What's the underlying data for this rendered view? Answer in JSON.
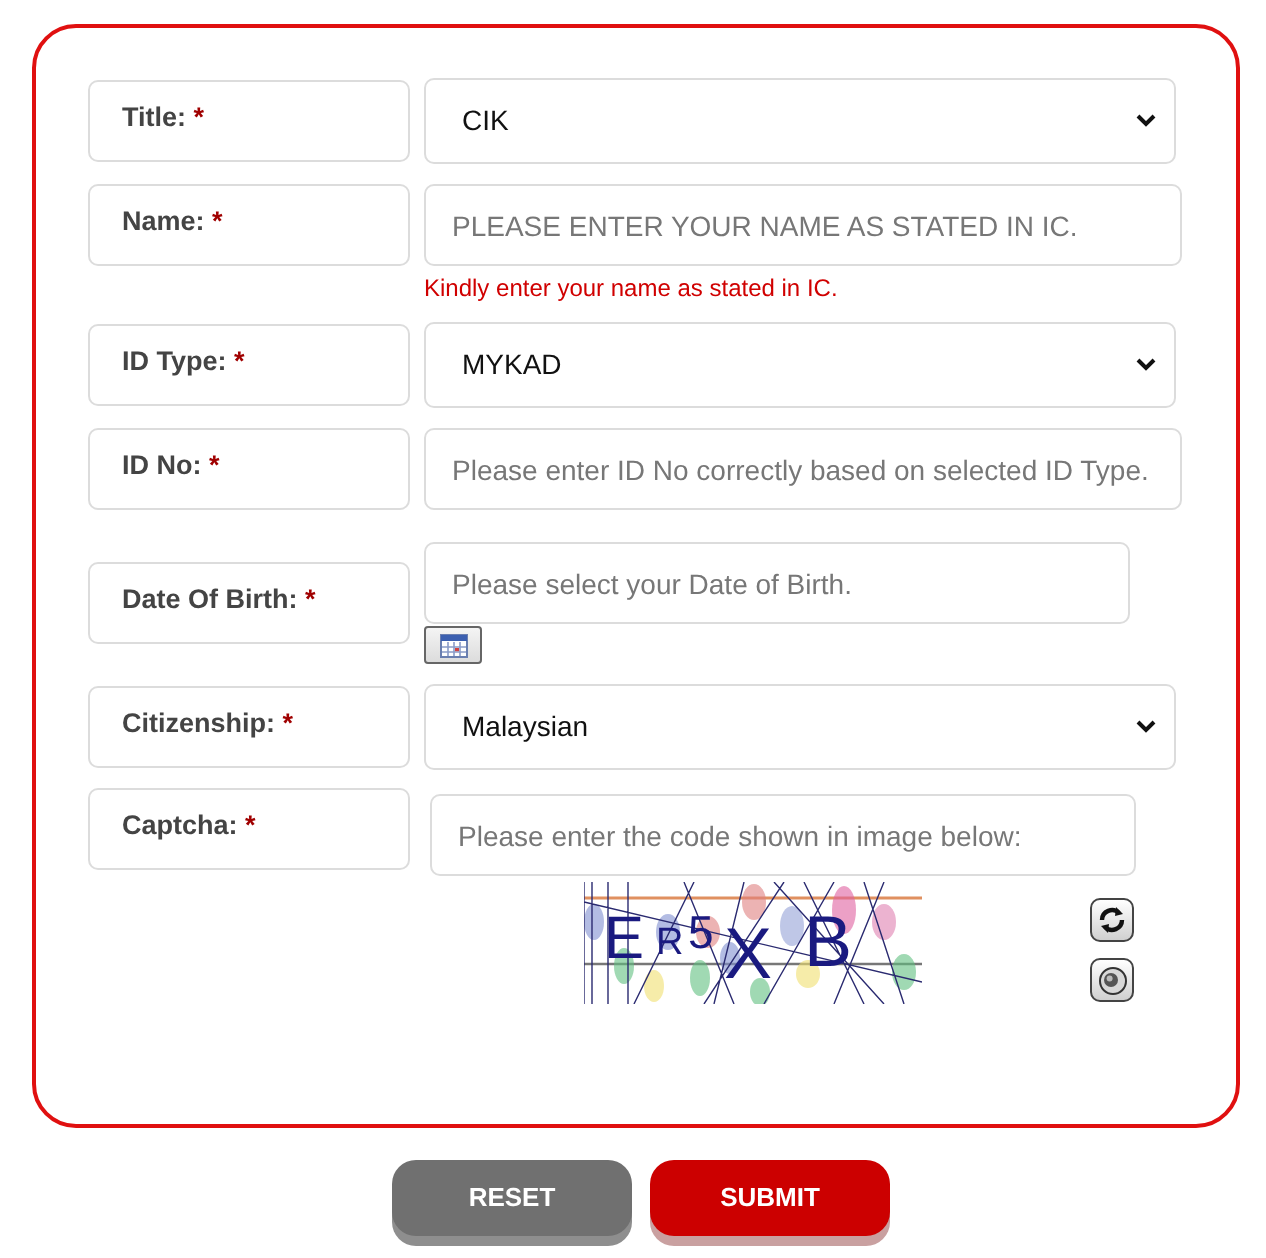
{
  "form": {
    "fields": [
      {
        "kind": "select",
        "label": "Title:",
        "required_mark": "*",
        "value": "CIK"
      },
      {
        "kind": "text",
        "label": "Name:",
        "required_mark": "*",
        "placeholder": "PLEASE ENTER YOUR NAME AS STATED IN IC.",
        "error": "Kindly enter your name as stated in IC."
      },
      {
        "kind": "select",
        "label": "ID Type:",
        "required_mark": "*",
        "value": "MYKAD"
      },
      {
        "kind": "text",
        "label": "ID No:",
        "required_mark": "*",
        "placeholder": "Please enter ID No correctly based on selected ID Type."
      },
      {
        "kind": "date",
        "label": "Date Of Birth:",
        "required_mark": "*",
        "placeholder": "Please select your Date of Birth."
      },
      {
        "kind": "select",
        "label": "Citizenship:",
        "required_mark": "*",
        "value": "Malaysian"
      },
      {
        "kind": "captcha",
        "label": "Captcha:",
        "required_mark": "*",
        "placeholder": "Please enter the code shown in image below:",
        "captcha_letters": [
          "E",
          "R",
          "5",
          "X",
          "B"
        ]
      }
    ]
  },
  "buttons": [
    {
      "kind": "reset",
      "label": "RESET"
    },
    {
      "kind": "submit",
      "label": "SUBMIT"
    }
  ]
}
